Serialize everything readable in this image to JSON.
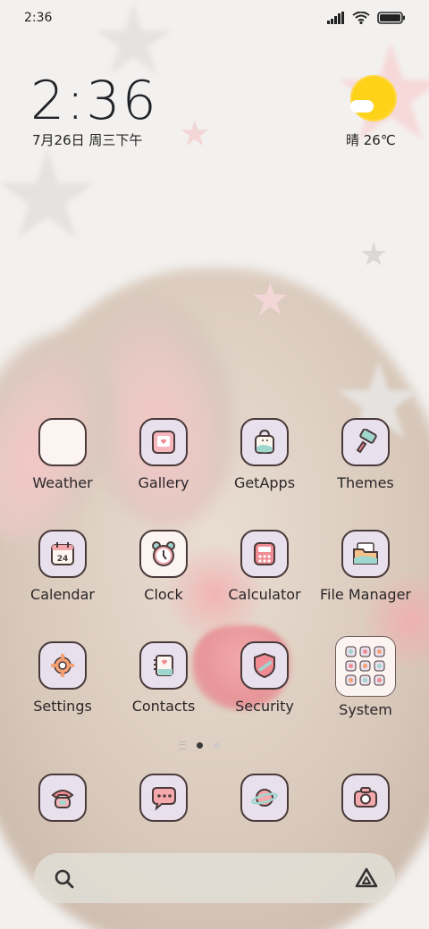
{
  "status_bar": {
    "time": "2:36",
    "icons": [
      "signal-icon",
      "wifi-icon",
      "battery-icon"
    ]
  },
  "clock_widget": {
    "time": "2:36",
    "date": "7月26日 周三下午"
  },
  "weather_widget": {
    "text": "晴 26℃",
    "icon": "sun-with-cloud-icon"
  },
  "apps": [
    {
      "id": "weather",
      "label": "Weather",
      "icon": "weather-icon"
    },
    {
      "id": "gallery",
      "label": "Gallery",
      "icon": "gallery-icon"
    },
    {
      "id": "getapps",
      "label": "GetApps",
      "icon": "shopping-bag-icon"
    },
    {
      "id": "themes",
      "label": "Themes",
      "icon": "paint-brush-icon"
    },
    {
      "id": "calendar",
      "label": "Calendar",
      "icon": "calendar-icon",
      "badge": "24"
    },
    {
      "id": "clock",
      "label": "Clock",
      "icon": "alarm-clock-icon"
    },
    {
      "id": "calculator",
      "label": "Calculator",
      "icon": "calculator-icon"
    },
    {
      "id": "file_manager",
      "label": "File Manager",
      "icon": "folder-icon"
    },
    {
      "id": "settings",
      "label": "Settings",
      "icon": "gear-icon"
    },
    {
      "id": "contacts",
      "label": "Contacts",
      "icon": "contacts-book-icon"
    },
    {
      "id": "security",
      "label": "Security",
      "icon": "shield-icon"
    },
    {
      "id": "system",
      "label": "System",
      "icon": "app-folder-icon"
    }
  ],
  "dock": [
    {
      "id": "phone",
      "icon": "phone-icon"
    },
    {
      "id": "messages",
      "icon": "chat-bubble-icon"
    },
    {
      "id": "browser",
      "icon": "planet-icon"
    },
    {
      "id": "camera",
      "icon": "camera-icon"
    }
  ],
  "page_indicator": {
    "pages": 2,
    "current": 1
  },
  "search_bar": {
    "left_icon": "search-icon",
    "right_icon": "assistant-icon"
  },
  "colors": {
    "icon_bg": "#e8e0ec",
    "icon_border": "#4a3a3a",
    "accent_pink": "#f0a3a8",
    "sun": "#ffd21a"
  }
}
